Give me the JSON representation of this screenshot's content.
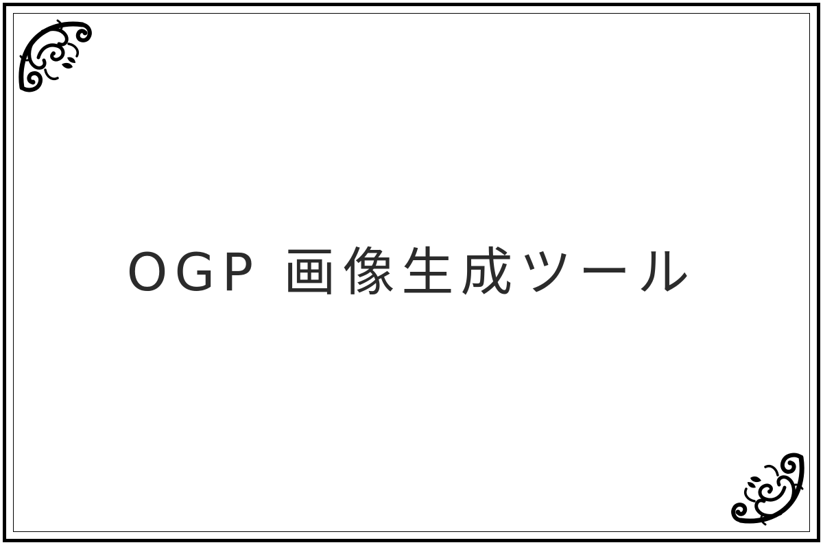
{
  "ogp_card": {
    "title": "OGP 画像生成ツール",
    "text_color": "#2b2b2b",
    "frame_color": "#000000",
    "background": "#ffffff",
    "ornaments": [
      {
        "icon": "flourish-corner-icon",
        "corner": "top-left"
      },
      {
        "icon": "flourish-corner-icon",
        "corner": "bottom-right"
      }
    ]
  }
}
